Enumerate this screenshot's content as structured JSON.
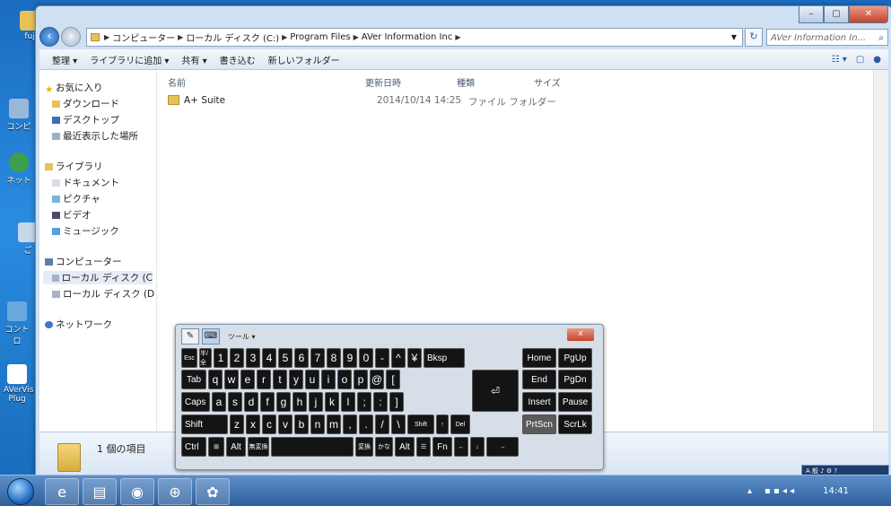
{
  "desktop": {
    "icons": [
      "fuj",
      "コンピ",
      "ネット",
      "ご",
      "コントロ",
      "AVerVis Plug"
    ]
  },
  "window": {
    "controls": {
      "minimize": "–",
      "maximize": "▢",
      "close": "✕"
    },
    "address": {
      "segments": [
        "コンピューター",
        "ローカル ディスク (C:)",
        "Program Files",
        "AVer Information Inc"
      ],
      "search_placeholder": "AVer Information In..."
    },
    "toolbar": {
      "items": [
        "整理 ▾",
        "ライブラリに追加 ▾",
        "共有 ▾",
        "書き込む",
        "新しいフォルダー"
      ]
    },
    "nav": {
      "favorites": "お気に入り",
      "fav_items": [
        "ダウンロード",
        "デスクトップ",
        "最近表示した場所"
      ],
      "libraries": "ライブラリ",
      "lib_items": [
        "ドキュメント",
        "ピクチャ",
        "ビデオ",
        "ミュージック"
      ],
      "computer": "コンピューター",
      "comp_items": [
        "ローカル ディスク (C",
        "ローカル ディスク (D"
      ],
      "network": "ネットワーク"
    },
    "columns": {
      "name": "名前",
      "date": "更新日時",
      "type": "種類",
      "size": "サイズ"
    },
    "rows": [
      {
        "name": "A+ Suite",
        "date": "2014/10/14 14:25",
        "type": "ファイル フォルダー",
        "size": ""
      }
    ],
    "status": "1 個の項目"
  },
  "osk": {
    "menu": "ツール ▾",
    "close": "x",
    "row1": [
      "Esc",
      "半/全",
      "1",
      "2",
      "3",
      "4",
      "5",
      "6",
      "7",
      "8",
      "9",
      "0",
      "-",
      "^",
      "¥",
      "Bksp",
      "Home",
      "PgUp"
    ],
    "row2": [
      "Tab",
      "q",
      "w",
      "e",
      "r",
      "t",
      "y",
      "u",
      "i",
      "o",
      "p",
      "@",
      "[",
      "End",
      "PgDn"
    ],
    "row3": [
      "Caps",
      "a",
      "s",
      "d",
      "f",
      "g",
      "h",
      "j",
      "k",
      "l",
      ";",
      ":",
      "]",
      "Insert",
      "Pause"
    ],
    "row4": [
      "Shift",
      "z",
      "x",
      "c",
      "v",
      "b",
      "n",
      "m",
      ",",
      ".",
      "/",
      "\\",
      "Shift",
      "↑",
      "Del",
      "PrtScn",
      "ScrLk"
    ],
    "row5": [
      "Ctrl",
      "⊞",
      "Alt",
      "無変換",
      "",
      "変換",
      "かな",
      "Alt",
      "☰",
      "Fn",
      "←",
      "↓",
      "→"
    ],
    "enter": "⏎"
  },
  "taskbar": {
    "clock": "14:41",
    "lang": "A 般 ♪ ⚙ ?"
  }
}
